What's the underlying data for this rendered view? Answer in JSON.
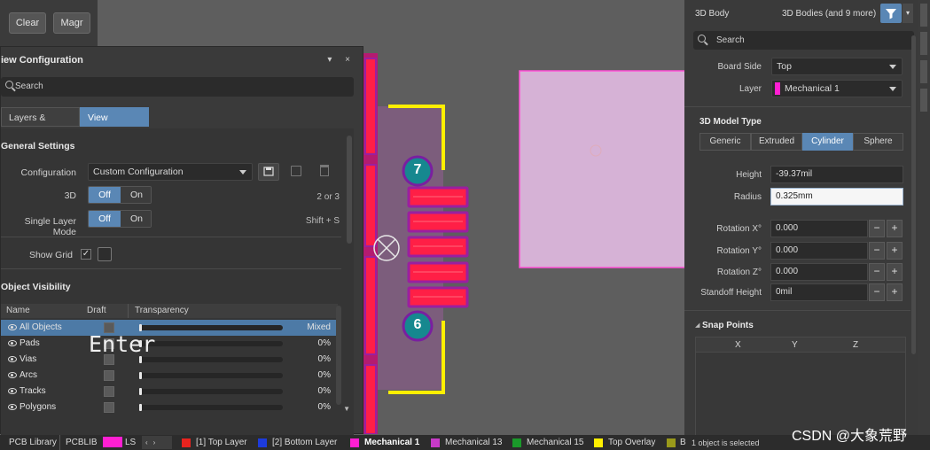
{
  "toolbar": {
    "clear_label": "Clear",
    "magnify_label": "Magr"
  },
  "pcb": {
    "pad_label_top": "7",
    "pad_label_bottom": "6",
    "pad_color": "#ff1f46",
    "silkscreen_color": "#ffef00",
    "keepout_color": "#c830c8"
  },
  "view_config": {
    "title": "iew Configuration",
    "search_placeholder": "Search",
    "tabs": [
      {
        "label": "Layers & Colors",
        "active": false
      },
      {
        "label": "View Options",
        "active": true
      }
    ],
    "general_settings_heading": "General Settings",
    "configuration_label": "Configuration",
    "configuration_value": "Custom Configuration",
    "three_d_label": "3D",
    "three_d_off": "Off",
    "three_d_on": "On",
    "three_d_shortcut": "2 or 3",
    "single_layer_label": "Single Layer Mode",
    "single_layer_off": "Off",
    "single_layer_on": "On",
    "single_layer_shortcut": "Shift + S",
    "show_grid_label": "Show Grid",
    "object_visibility_heading": "Object Visibility",
    "columns": {
      "name": "Name",
      "draft": "Draft",
      "transparency": "Transparency"
    },
    "rows": [
      {
        "name": "All Objects",
        "value": "Mixed",
        "selected": true
      },
      {
        "name": "Pads",
        "value": "0%",
        "selected": false
      },
      {
        "name": "Vias",
        "value": "0%",
        "selected": false
      },
      {
        "name": "Arcs",
        "value": "0%",
        "selected": false
      },
      {
        "name": "Tracks",
        "value": "0%",
        "selected": false
      },
      {
        "name": "Polygons",
        "value": "0%",
        "selected": false
      }
    ]
  },
  "enter_hint": "Enter",
  "properties": {
    "object_type": "3D Body",
    "filter_label": "3D Bodies (and 9 more)",
    "search_placeholder": "Search",
    "board_side_label": "Board Side",
    "board_side_value": "Top",
    "layer_label": "Layer",
    "layer_value": "Mechanical 1",
    "layer_color": "#ff1fd2",
    "model_type_heading": "3D Model Type",
    "model_types": [
      {
        "label": "Generic",
        "active": false
      },
      {
        "label": "Extruded",
        "active": false
      },
      {
        "label": "Cylinder",
        "active": true
      },
      {
        "label": "Sphere",
        "active": false
      }
    ],
    "height_label": "Height",
    "height_value": "-39.37mil",
    "radius_label": "Radius",
    "radius_value": "0.325mm",
    "rotation_x_label": "Rotation X°",
    "rotation_x_value": "0.000",
    "rotation_y_label": "Rotation Y°",
    "rotation_y_value": "0.000",
    "rotation_z_label": "Rotation Z°",
    "rotation_z_value": "0.000",
    "standoff_label": "Standoff Height",
    "standoff_value": "0mil",
    "snap_points_heading": "Snap Points",
    "snap_columns": {
      "x": "X",
      "y": "Y",
      "z": "Z"
    }
  },
  "status_bar": {
    "items": [
      {
        "label": "PCB Library"
      },
      {
        "label": "PCBLIB"
      },
      {
        "label": "LS",
        "color": "#ff1fd2"
      },
      {
        "label": "[1] Top Layer",
        "color": "#e8231e"
      },
      {
        "label": "[2] Bottom Layer",
        "color": "#1d3bdc"
      },
      {
        "label": "Mechanical 1",
        "color": "#ff1fd2"
      },
      {
        "label": "Mechanical 13",
        "color": "#c83ac8"
      },
      {
        "label": "Mechanical 15",
        "color": "#1a9a2a"
      },
      {
        "label": "Top Overlay",
        "color": "#ffef00"
      },
      {
        "label": "B",
        "color": "#9a9a1a"
      }
    ],
    "selection_status": "1 object is selected"
  },
  "watermark": "CSDN @大象荒野"
}
